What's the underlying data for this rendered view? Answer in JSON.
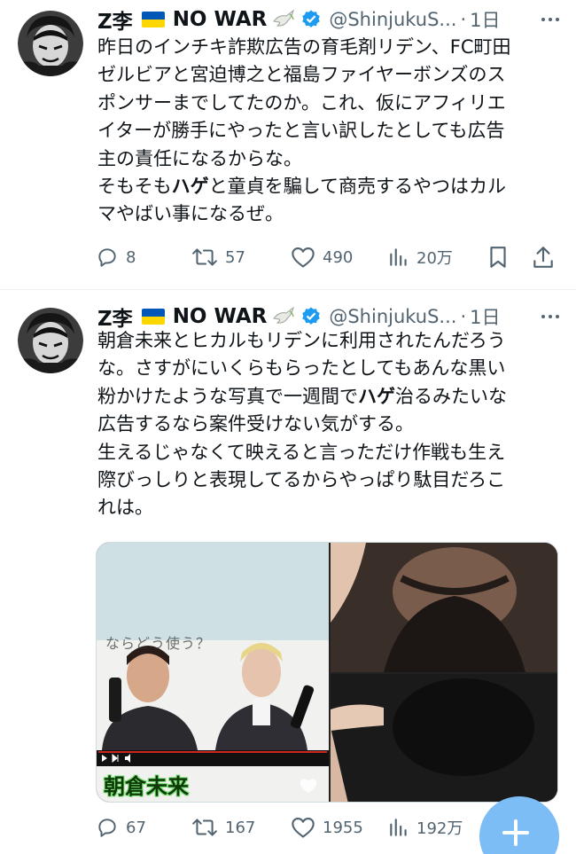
{
  "tweets": [
    {
      "author": {
        "name": "Z李",
        "suffix": "NO WAR",
        "handle": "@ShinjukuS...",
        "separator": "·",
        "time": "1日"
      },
      "lines": [
        [
          "昨日のインチキ詐欺広告の育毛剤リデン、FC町田"
        ],
        [
          "ゼルビアと宮迫博之と福島ファイヤーボンズのス"
        ],
        [
          "ポンサーまでしてたのか。これ、仮にアフィリエ"
        ],
        [
          "イターが勝手にやったと言い訳したとしても広告"
        ],
        [
          "主の責任になるからな。"
        ],
        [
          "そもそも",
          "ハゲ",
          "と童貞を騙して商売するやつはカル"
        ],
        [
          "マやばい事になるぜ。"
        ]
      ],
      "actions": {
        "replies": "8",
        "retweets": "57",
        "likes": "490",
        "views": "20万"
      }
    },
    {
      "author": {
        "name": "Z李",
        "suffix": "NO WAR",
        "handle": "@ShinjukuS...",
        "separator": "·",
        "time": "1日"
      },
      "lines": [
        [
          "朝倉未来とヒカルもリデンに利用されたんだろう"
        ],
        [
          "な。さすがにいくらもらったとしてもあんな黒い"
        ],
        [
          "粉かけたような写真で一週間で",
          "ハゲ",
          "治るみたいな"
        ],
        [
          "広告するなら案件受けない気がする。"
        ],
        [
          "生えるじゃなくて映えると言っただけ作戦も生え"
        ],
        [
          "際びっしりと表現してるからやっぱり駄目だろこ"
        ],
        [
          "れは。"
        ]
      ],
      "media": {
        "overlay_text": "ならどう使う？",
        "caption": "朝倉未来"
      },
      "actions": {
        "replies": "67",
        "retweets": "167",
        "likes": "1955",
        "views": "192万"
      }
    }
  ],
  "icons": {
    "more": "more-horizontal-icon",
    "verified": "verified-badge-icon",
    "dove": "dove-icon",
    "reply": "reply-icon",
    "retweet": "retweet-icon",
    "like": "heart-icon",
    "views": "views-icon",
    "bookmark": "bookmark-icon",
    "share": "share-icon",
    "compose": "compose-plus-icon"
  },
  "colors": {
    "text": "#0f1419",
    "secondary": "#536471",
    "verified": "#1d9bf0",
    "fab": "#7dbdf5"
  }
}
